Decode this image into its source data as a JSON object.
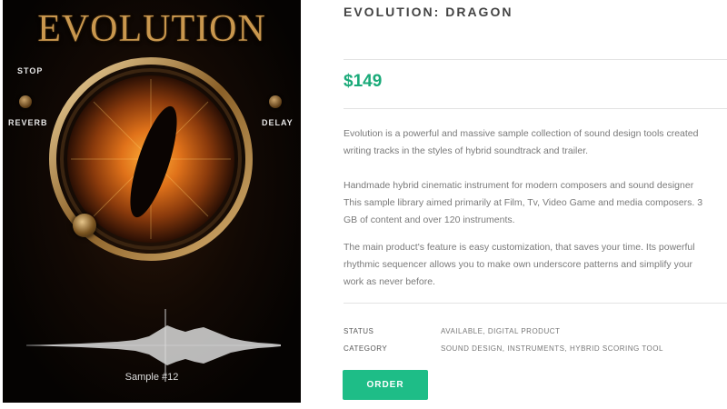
{
  "image": {
    "brand": "EVOLUTION",
    "controls": {
      "stop": "STOP",
      "reverb": "REVERB",
      "delay": "DELAY"
    },
    "sample_label": "Sample #12"
  },
  "product": {
    "title": "EVOLUTION: DRAGON",
    "price": "$149",
    "description": {
      "p1_line1": "Evolution is a powerful and massive sample collection of sound design tools created",
      "p1_line2": "writing tracks in the styles of hybrid soundtrack and trailer.",
      "p2_line1": "Handmade hybrid cinematic instrument for modern composers and sound designer",
      "p2_line2": "This sample library aimed primarily at Film, Tv, Video Game and media composers. 3",
      "p2_line3": "GB of content and over 120 instruments.",
      "p3_line1": "The main product's feature is easy customization, that saves your time. Its powerful",
      "p3_line2": "rhythmic sequencer allows you to make own underscore patterns and simplify your",
      "p3_line3": "work as never before."
    },
    "meta": {
      "status_label": "STATUS",
      "status_value": "AVAILABLE, DIGITAL PRODUCT",
      "category_label": "CATEGORY",
      "category_value": "SOUND DESIGN, INSTRUMENTS, HYBRID SCORING TOOL"
    },
    "order_label": "ORDER"
  },
  "colors": {
    "accent": "#1ebd87",
    "price": "#1aaa79"
  }
}
